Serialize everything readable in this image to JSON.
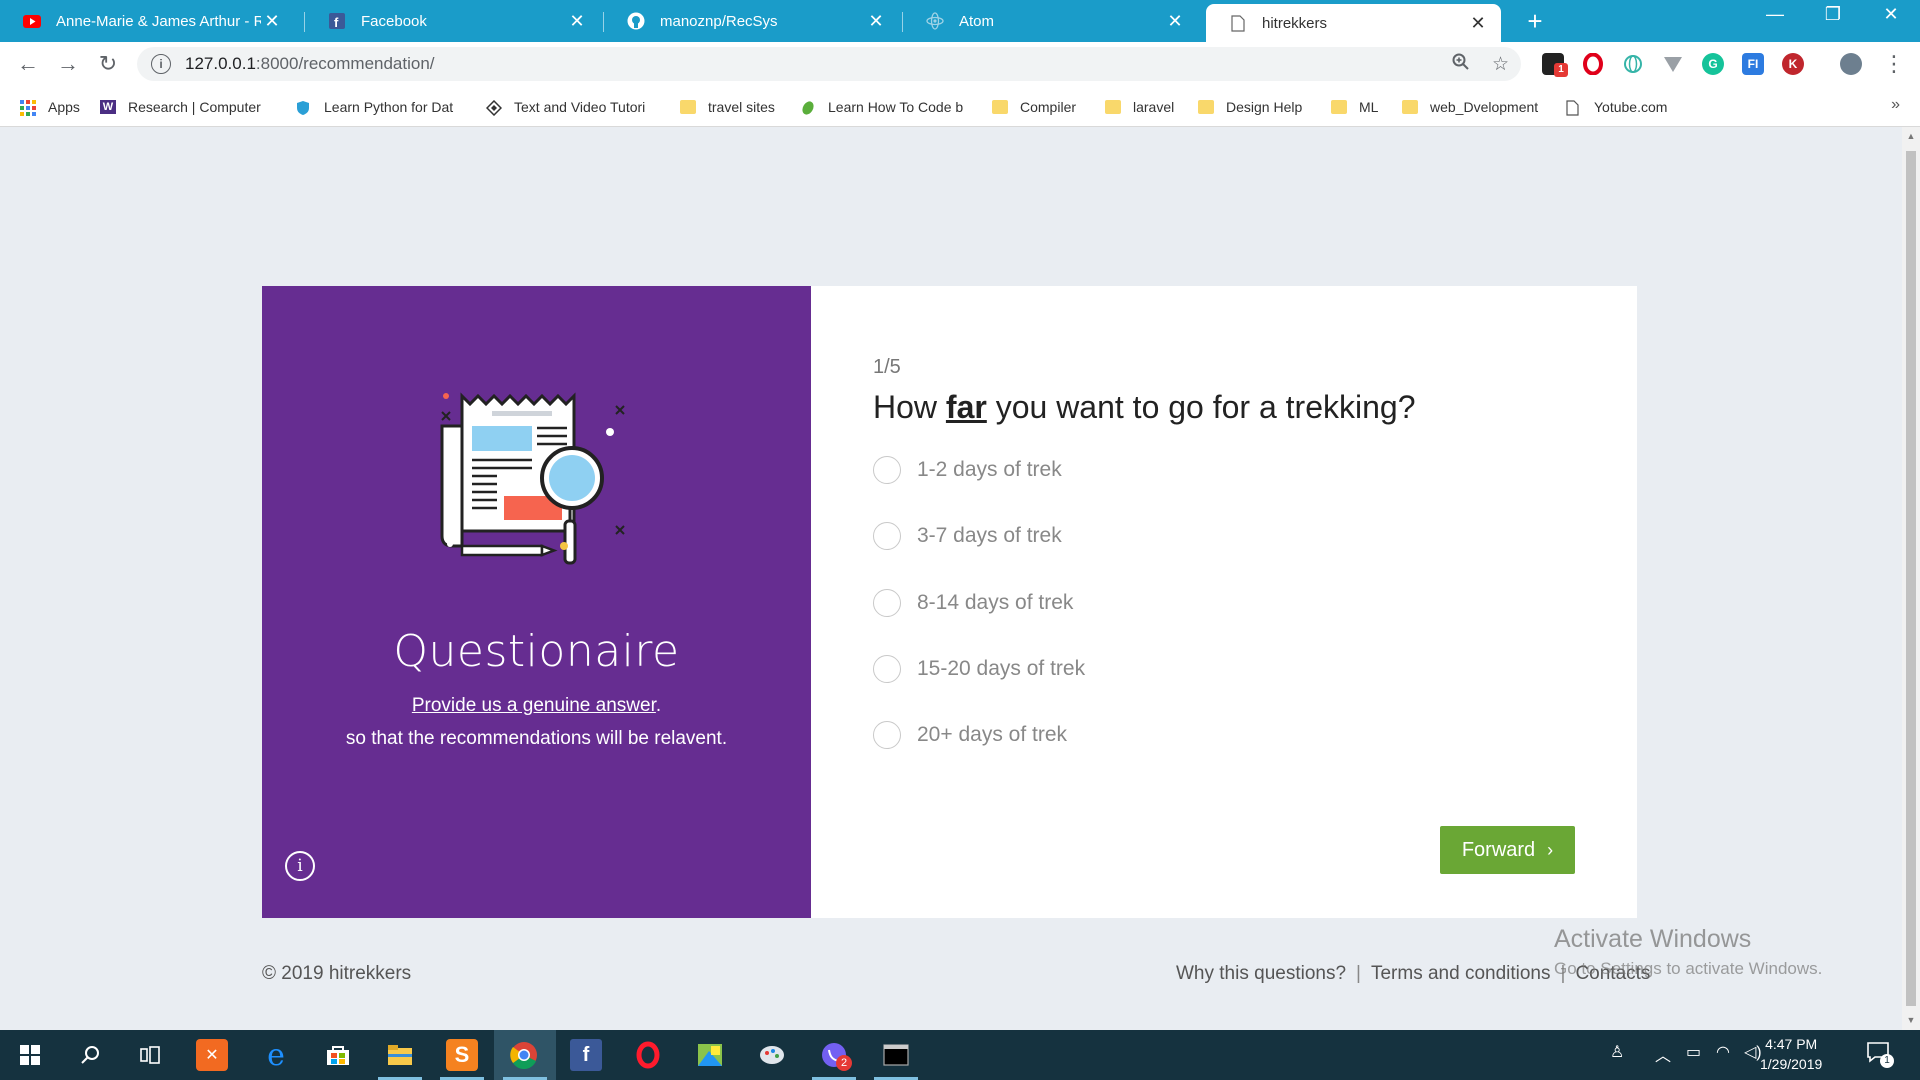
{
  "browser": {
    "tabs": [
      {
        "title": "Anne-Marie & James Arthur - Re",
        "icon": "youtube-icon",
        "active": false
      },
      {
        "title": "Facebook",
        "icon": "facebook-icon",
        "active": false
      },
      {
        "title": "manoznp/RecSys",
        "icon": "github-icon",
        "active": false
      },
      {
        "title": "Atom",
        "icon": "atom-icon",
        "active": false
      },
      {
        "title": "hitrekkers",
        "icon": "page-icon",
        "active": true
      }
    ],
    "new_tab": "+",
    "address": {
      "host": "127.0.0.1",
      "path": ":8000/recommendation/"
    },
    "bookmarks": [
      {
        "label": "Apps",
        "icon": "apps-grid-icon"
      },
      {
        "label": "Research | Computer",
        "icon": "w-logo-icon"
      },
      {
        "label": "Learn Python for Dat",
        "icon": "shield-icon"
      },
      {
        "label": "Text and Video Tutori",
        "icon": "diamond-icon"
      },
      {
        "label": "travel sites",
        "icon": "folder-icon"
      },
      {
        "label": "Learn How To Code b",
        "icon": "leaf-icon"
      },
      {
        "label": "Compiler",
        "icon": "folder-icon"
      },
      {
        "label": "laravel",
        "icon": "folder-icon"
      },
      {
        "label": "Design Help",
        "icon": "folder-icon"
      },
      {
        "label": "ML",
        "icon": "folder-icon"
      },
      {
        "label": "web_Dvelopment",
        "icon": "folder-icon"
      },
      {
        "label": "Yotube.com",
        "icon": "page-icon"
      }
    ],
    "extension_badge": "1"
  },
  "panel": {
    "title": "Questionaire",
    "subtitle_link": "Provide us a genuine answer",
    "subtitle_end": ".",
    "subtitle_2": "so that the recommendations will be relavent.",
    "info": "i",
    "colors": {
      "background": "#662d91"
    }
  },
  "quiz": {
    "step": "1/5",
    "question_pre": "How ",
    "question_em": "far",
    "question_post": " you want to go for a trekking?",
    "options": [
      "1-2 days of trek",
      "3-7 days of trek",
      "8-14 days of trek",
      "15-20 days of trek",
      "20+ days of trek"
    ],
    "forward_label": "Forward",
    "colors": {
      "button": "#6aa735"
    }
  },
  "footer": {
    "copyright": "© 2019 hitrekkers",
    "links": [
      "Why this questions?",
      "Terms and conditions",
      "Contacts"
    ],
    "separator": "|"
  },
  "watermark": {
    "line1": "Activate Windows",
    "line2": "Go to Settings to activate Windows."
  },
  "taskbar": {
    "time": "4:47 PM",
    "date": "1/29/2019",
    "notification_count": "1",
    "viber_badge": "2"
  }
}
